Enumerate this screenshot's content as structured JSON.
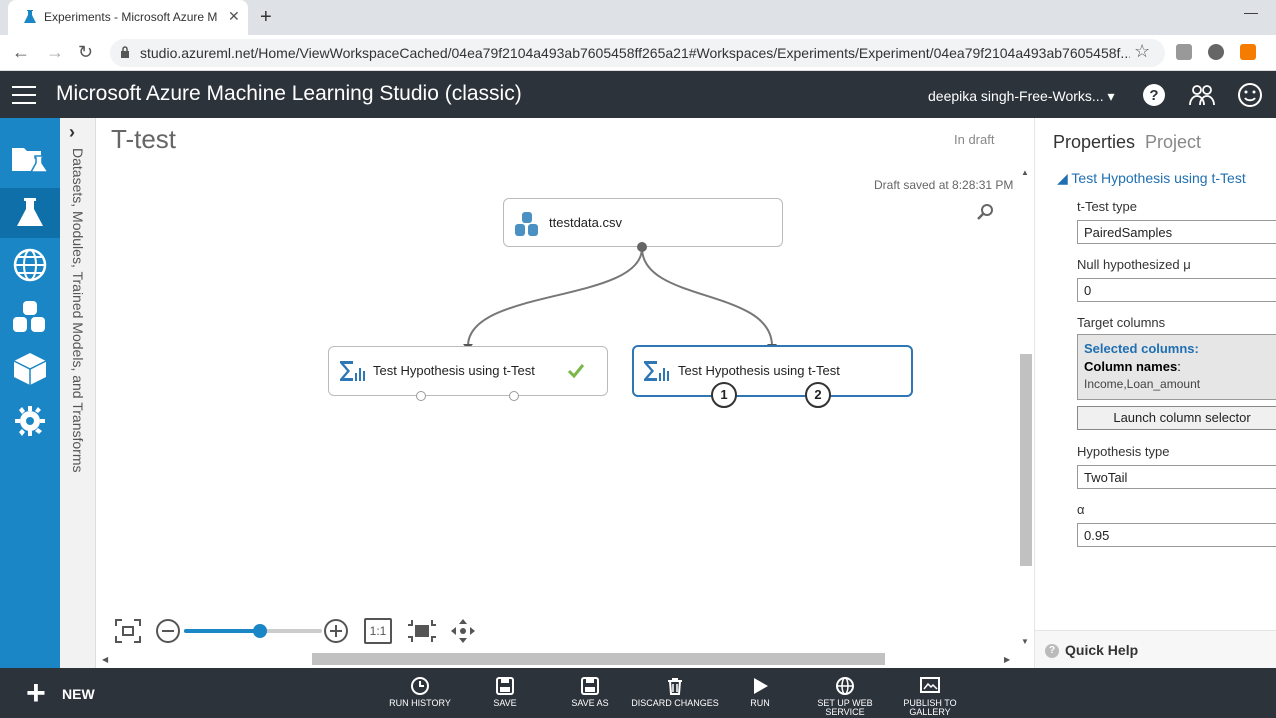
{
  "browser": {
    "tab_title": "Experiments - Microsoft Azure M",
    "url": "studio.azureml.net/Home/ViewWorkspaceCached/04ea79f2104a493ab7605458ff265a21#Workspaces/Experiments/Experiment/04ea79f2104a493ab7605458f..."
  },
  "header": {
    "app_title": "Microsoft Azure Machine Learning Studio (classic)",
    "workspace": "deepika singh-Free-Works... ▾"
  },
  "palette": {
    "label": "Datasets, Modules, Trained Models, and Transforms"
  },
  "canvas": {
    "experiment_title": "T-test",
    "status": "In draft",
    "draft_saved": "Draft saved at 8:28:31 PM",
    "modules": [
      {
        "label": "ttestdata.csv"
      },
      {
        "label": "Test Hypothesis using t-Test"
      },
      {
        "label": "Test Hypothesis using t-Test"
      }
    ],
    "ports": [
      "1",
      "2"
    ],
    "zoom": {
      "level": 0.55,
      "one_to_one": "1:1"
    }
  },
  "properties": {
    "tab_properties": "Properties",
    "tab_project": "Project",
    "section": "Test Hypothesis using t-Test",
    "ttest_type_label": "t-Test type",
    "ttest_type_value": "PairedSamples",
    "null_mu_label": "Null hypothesized μ",
    "null_mu_value": "0",
    "target_columns_label": "Target columns",
    "selected_columns": "Selected columns:",
    "column_names_label": "Column names",
    "column_names_value": "Income,Loan_amount",
    "launch_button": "Launch column selector",
    "hypothesis_type_label": "Hypothesis type",
    "hypothesis_type_value": "TwoTail",
    "alpha_label": "α",
    "alpha_value": "0.95",
    "quick_help": "Quick Help"
  },
  "bottombar": {
    "new_label": "NEW",
    "commands": [
      {
        "label": "RUN HISTORY"
      },
      {
        "label": "SAVE"
      },
      {
        "label": "SAVE AS"
      },
      {
        "label": "DISCARD CHANGES"
      },
      {
        "label": "RUN"
      },
      {
        "label": "SET UP WEB SERVICE"
      },
      {
        "label": "PUBLISH TO GALLERY"
      }
    ]
  },
  "colors": {
    "accent": "#1b86c5",
    "header_bg": "#2d333b",
    "link_blue": "#1f6fb2",
    "check_green": "#7ab648"
  }
}
